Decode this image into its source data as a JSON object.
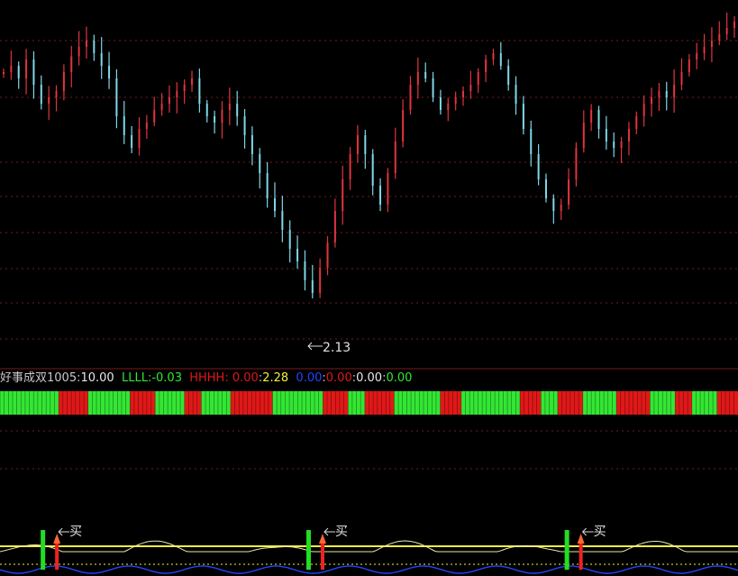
{
  "colors": {
    "background": "#000000",
    "up": "#e0343f",
    "down": "#7fd8e8",
    "grid": "#7a1a1a",
    "band_green": "#33e633",
    "band_red": "#e01818",
    "signal_yellow": "#f0f040",
    "signal_green": "#22dd22",
    "signal_red": "#ee2222",
    "osc_white": "#e8e8b0",
    "osc_blue": "#2244ff"
  },
  "legend": {
    "name": "好事成双1005",
    "v1": "10.00",
    "l_label": "LLLL:",
    "l_value": "-0.03",
    "h_label": "HHHH:",
    "h_value": "0.00",
    "v2": "2.28",
    "v3": "0.00",
    "v4": "0.00",
    "v5": "0.00",
    "v6": "0.00",
    "colon": ":"
  },
  "chart_data": {
    "type": "candlestick",
    "annotations": {
      "low_marker": "2.13",
      "buy_label": "买",
      "buy_positions": [
        0.06,
        0.42,
        0.77
      ]
    },
    "price_path": [
      0.2,
      0.18,
      0.22,
      0.16,
      0.24,
      0.3,
      0.28,
      0.26,
      0.2,
      0.15,
      0.12,
      0.1,
      0.14,
      0.18,
      0.22,
      0.34,
      0.4,
      0.44,
      0.38,
      0.36,
      0.32,
      0.3,
      0.28,
      0.26,
      0.24,
      0.22,
      0.3,
      0.34,
      0.36,
      0.32,
      0.3,
      0.34,
      0.4,
      0.46,
      0.52,
      0.6,
      0.64,
      0.7,
      0.76,
      0.8,
      0.86,
      0.9,
      0.82,
      0.74,
      0.64,
      0.54,
      0.46,
      0.4,
      0.46,
      0.56,
      0.62,
      0.52,
      0.42,
      0.32,
      0.24,
      0.2,
      0.22,
      0.28,
      0.32,
      0.3,
      0.28,
      0.26,
      0.24,
      0.2,
      0.16,
      0.14,
      0.18,
      0.24,
      0.3,
      0.38,
      0.46,
      0.54,
      0.6,
      0.64,
      0.62,
      0.54,
      0.44,
      0.36,
      0.32,
      0.38,
      0.42,
      0.44,
      0.42,
      0.38,
      0.34,
      0.3,
      0.28,
      0.26,
      0.28,
      0.24,
      0.2,
      0.16,
      0.14,
      0.12,
      0.1,
      0.08,
      0.06,
      0.04
    ],
    "band_pattern": [
      1,
      1,
      1,
      1,
      1,
      1,
      1,
      1,
      1,
      1,
      1,
      1,
      1,
      1,
      0,
      0,
      0,
      0,
      0,
      0,
      0,
      1,
      1,
      1,
      1,
      1,
      1,
      1,
      1,
      1,
      1,
      0,
      0,
      0,
      0,
      0,
      0,
      1,
      1,
      1,
      1,
      1,
      1,
      1,
      0,
      0,
      0,
      0,
      1,
      1,
      1,
      1,
      1,
      1,
      1,
      0,
      0,
      0,
      0,
      0,
      0,
      0,
      0,
      0,
      0,
      1,
      1,
      1,
      1,
      1,
      1,
      1,
      1,
      1,
      1,
      1,
      1,
      0,
      0,
      0,
      0,
      0,
      0,
      1,
      1,
      1,
      1,
      0,
      0,
      0,
      0,
      0,
      0,
      0,
      1,
      1,
      1,
      1,
      1,
      1,
      1,
      1,
      1,
      1,
      1,
      0,
      0,
      0,
      0,
      0,
      1,
      1,
      1,
      1,
      1,
      1,
      1,
      1,
      1,
      1,
      1,
      1,
      1,
      1,
      0,
      0,
      0,
      0,
      0,
      1,
      1,
      1,
      1,
      0,
      0,
      0,
      0,
      0,
      0,
      1,
      1,
      1,
      1,
      1,
      1,
      1,
      1,
      0,
      0,
      0,
      0,
      0,
      0,
      0,
      0,
      1,
      1,
      1,
      1,
      1,
      1,
      0,
      0,
      0,
      0,
      1,
      1,
      1,
      1,
      1,
      1,
      0,
      0,
      0,
      0,
      0
    ]
  }
}
